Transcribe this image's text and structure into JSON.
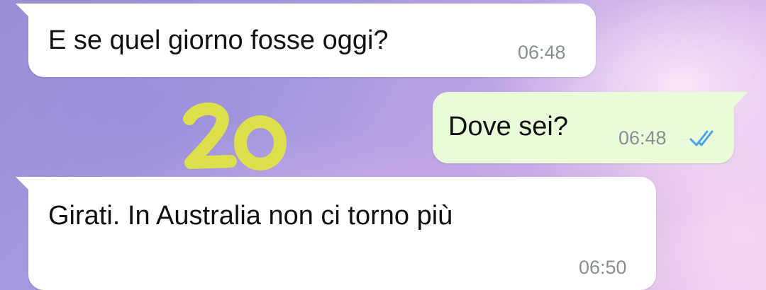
{
  "messages": [
    {
      "direction": "incoming",
      "text": "E se quel giorno fosse oggi?",
      "time": "06:48"
    },
    {
      "direction": "outgoing",
      "text": "Dove sei?",
      "time": "06:48",
      "status": "read",
      "status_icon": "double-check-icon"
    },
    {
      "direction": "incoming",
      "text": "Girati. In Australia non ci torno più",
      "time": "06:50"
    }
  ],
  "doodle": {
    "text": "20",
    "color": "#dde04a"
  },
  "colors": {
    "incoming_bubble": "#ffffff",
    "outgoing_bubble": "#e9fbd8",
    "read_ticks": "#4aa3e8",
    "timestamp": "#8a8f93"
  }
}
